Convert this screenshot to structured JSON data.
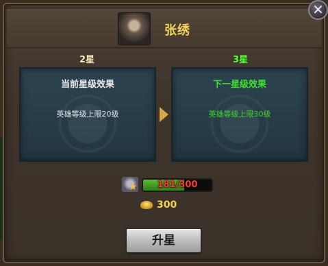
{
  "hero": {
    "name": "张绣"
  },
  "current": {
    "star_label": "2星",
    "title": "当前星级效果",
    "effect": "英雄等级上限20级"
  },
  "next": {
    "star_label": "3星",
    "title": "下一星级效果",
    "effect": "英雄等级上限30级"
  },
  "material": {
    "progress_text": "181/300",
    "current": 181,
    "required": 300
  },
  "gold": {
    "amount": "300"
  },
  "upgrade_button": {
    "label": "升星"
  },
  "close_button": {
    "glyph": "✕"
  },
  "colors": {
    "current": "#e9ecef",
    "next": "#3fe22a",
    "gold": "#f5d64a",
    "progress_text": "#ff3a2e"
  },
  "icons": [
    "close-icon",
    "hero-portrait",
    "arrow-right-icon",
    "material-icon",
    "gold-ingot-icon"
  ]
}
